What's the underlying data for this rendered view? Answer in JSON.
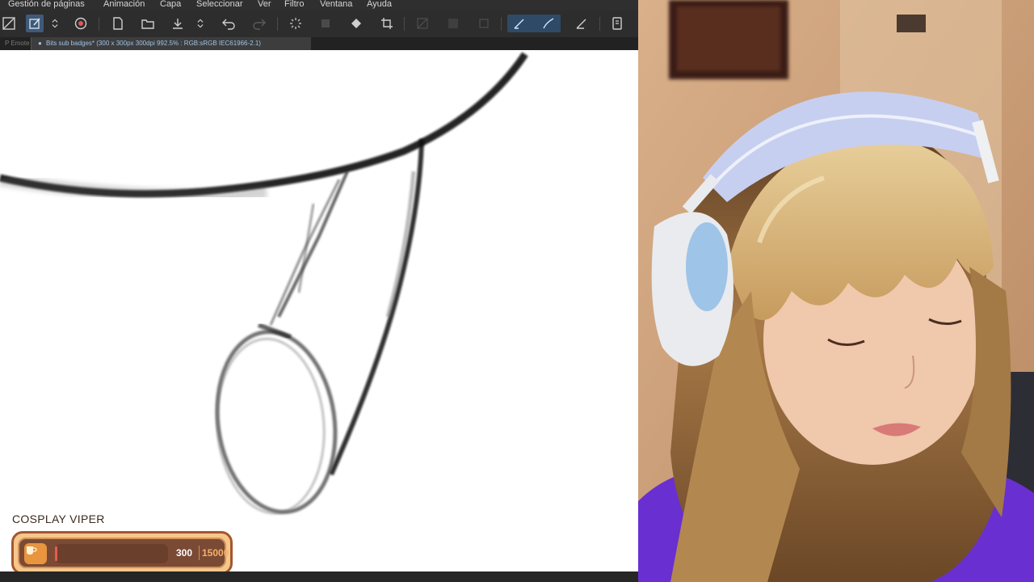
{
  "menubar": {
    "items": [
      "Gestión de páginas",
      "Animación",
      "Capa",
      "Seleccionar",
      "Ver",
      "Filtro",
      "Ventana",
      "Ayuda"
    ]
  },
  "toolbar": {
    "icons": [
      "transform-icon",
      "edit-icon",
      "chevron-updown-icon",
      "layer-icon",
      "new-file-icon",
      "open-folder-icon",
      "save-icon",
      "chevron-updown-icon",
      "undo-icon",
      "redo-icon",
      "loading-icon",
      "fill-icon",
      "bucket-icon",
      "crop-icon",
      "no-select-icon",
      "select-icon",
      "square-icon",
      "pen-icon",
      "brush-icon",
      "pencil-icon",
      "tablet-icon"
    ]
  },
  "tabs": {
    "side_label": "P Emote",
    "document_title": "Bits sub badges* (300 x 300px 300dpi 992.5% : RGB:sRGB IEC61966-2.1)"
  },
  "overlay": {
    "goal_title": "COSPLAY VIPER",
    "goal_current": "300",
    "goal_target": "15000",
    "goal_progress": 0.02,
    "colors": {
      "frame": "#f6c78b",
      "border": "#a4572f",
      "inner": "#7a4a34",
      "cup": "#e9943e",
      "fill": "#e85b4a",
      "target_text": "#f4b26b"
    }
  },
  "colors": {
    "accent": "#9ec2e6",
    "canvas": "#ffffff",
    "app_bg": "#2b2b2b"
  }
}
